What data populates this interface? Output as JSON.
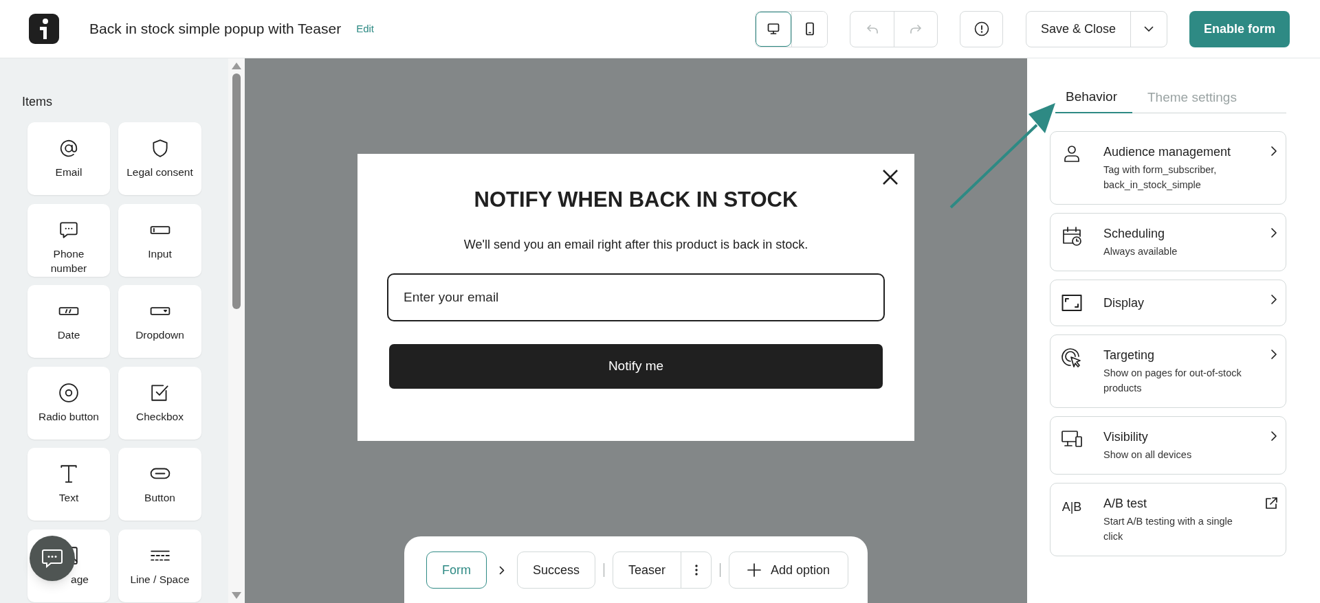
{
  "header": {
    "title": "Back in stock simple popup with Teaser",
    "edit_link": "Edit",
    "device_toggle": [
      {
        "kind": "desktop",
        "selected": true
      },
      {
        "kind": "mobile",
        "selected": false
      }
    ],
    "history": [
      {
        "kind": "undo",
        "disabled": true
      },
      {
        "kind": "redo",
        "disabled": true
      }
    ],
    "save_button": "Save & Close",
    "enable_button": "Enable form"
  },
  "items_panel": {
    "heading": "Items",
    "items": [
      {
        "label": "Email",
        "kind": "email"
      },
      {
        "label": "Legal consent",
        "kind": "shield"
      },
      {
        "label": "Phone number",
        "kind": "phone"
      },
      {
        "label": "Input",
        "kind": "input"
      },
      {
        "label": "Date",
        "kind": "date"
      },
      {
        "label": "Dropdown",
        "kind": "dropdown"
      },
      {
        "label": "Radio button",
        "kind": "radio"
      },
      {
        "label": "Checkbox",
        "kind": "checkbox"
      },
      {
        "label": "Text",
        "kind": "text"
      },
      {
        "label": "Button",
        "kind": "button"
      },
      {
        "label": "age",
        "kind": "image"
      },
      {
        "label": "Line / Space",
        "kind": "line"
      }
    ]
  },
  "popup": {
    "title": "NOTIFY WHEN BACK IN STOCK",
    "description": "We'll send you an email right after this product is back in stock.",
    "email_placeholder": "Enter your email",
    "button": "Notify me"
  },
  "steps": [
    {
      "label": "Form",
      "selected": true,
      "chevron_before": false,
      "divider_before": false,
      "menu": false
    },
    {
      "label": "Success",
      "selected": false,
      "chevron_before": true,
      "divider_before": false,
      "menu": false
    },
    {
      "label": "Teaser",
      "selected": false,
      "chevron_before": false,
      "divider_before": true,
      "menu": true
    }
  ],
  "add_option": "Add option",
  "settings_panel": {
    "tabs": [
      {
        "label": "Behavior",
        "selected": true
      },
      {
        "label": "Theme settings",
        "selected": false
      }
    ],
    "cards": [
      {
        "kind": "person",
        "title": "Audience management",
        "subtitle": "Tag with form_subscriber, back_in_stock_simple",
        "external": false
      },
      {
        "kind": "calendar",
        "title": "Scheduling",
        "subtitle": "Always available",
        "external": false
      },
      {
        "kind": "display",
        "title": "Display",
        "external": false
      },
      {
        "kind": "target",
        "title": "Targeting",
        "subtitle": "Show on pages for out-of-stock products",
        "external": false
      },
      {
        "kind": "devices",
        "title": "Visibility",
        "subtitle": "Show on all devices",
        "external": false
      },
      {
        "kind": "ab",
        "icon_text": "A|B",
        "title": "A/B test",
        "subtitle": "Start A/B testing with a single click",
        "external": true
      }
    ]
  }
}
